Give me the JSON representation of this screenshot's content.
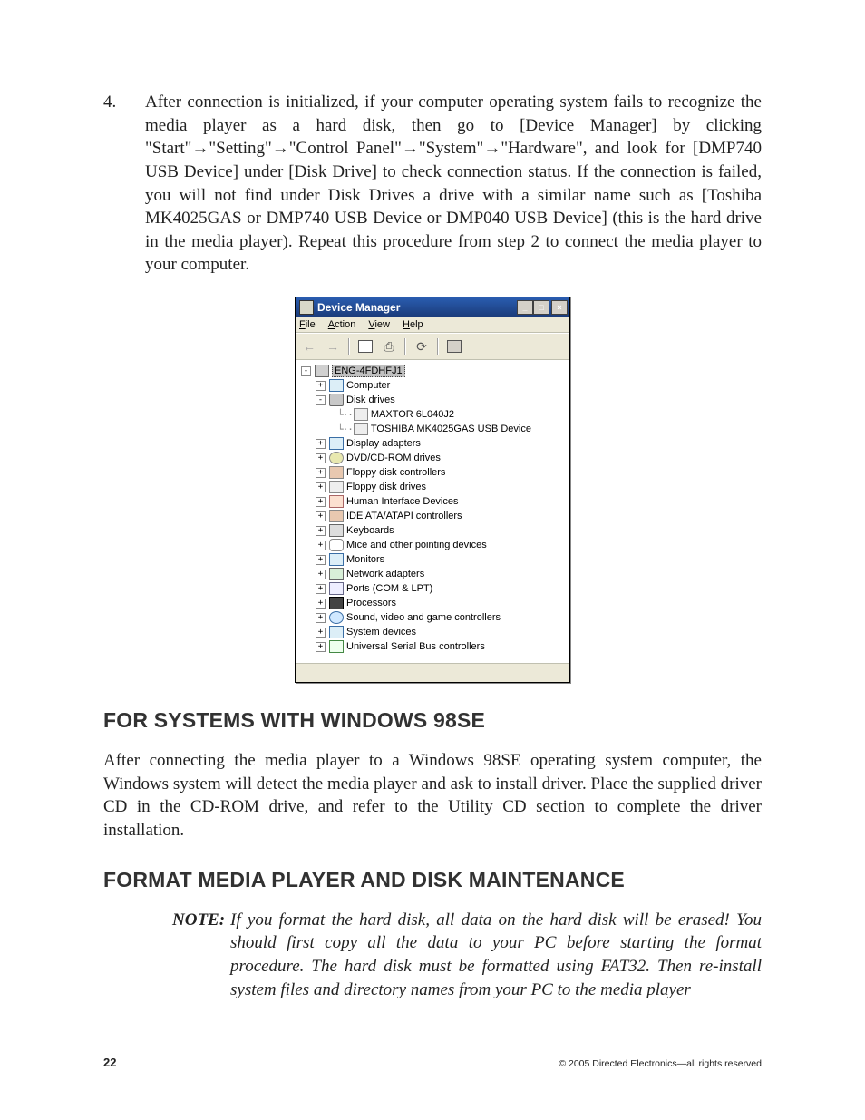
{
  "step": {
    "number": "4.",
    "text_part_1": "After connection is initialized, if your computer operating system fails to recognize the media player as a hard disk, then go to [Device Manager] by clicking \"Start\"",
    "arrow": "→",
    "text_part_2": "\"Setting\"",
    "text_part_3": "\"Control Panel\"",
    "text_part_4": "\"System\"",
    "text_part_5": "\"Hardware\", and look for [DMP740 USB Device] under [Disk Drive] to check connection status. If the connection is failed, you will not find under Disk Drives a drive with a similar name such as [Toshiba MK4025GAS or DMP740 USB Device or DMP040 USB Device] (this is the hard drive in the media player). Repeat this procedure from step 2 to connect the media player to your computer."
  },
  "device_manager": {
    "title": "Device Manager",
    "sysbtns": {
      "minimize": "_",
      "maximize": "□",
      "close": "×"
    },
    "menus": {
      "file_u": "F",
      "file": "ile",
      "action_u": "A",
      "action": "ction",
      "view_u": "V",
      "view": "iew",
      "help_u": "H",
      "help": "elp"
    },
    "root": "ENG-4FDHFJ1",
    "items": [
      {
        "exp": "+",
        "icon": "ico-monitor",
        "label": "Computer",
        "indent": 1
      },
      {
        "exp": "-",
        "icon": "ico-disk",
        "label": "Disk drives",
        "indent": 1
      },
      {
        "exp": "",
        "icon": "ico-drive",
        "label": "MAXTOR 6L040J2",
        "indent": 2
      },
      {
        "exp": "",
        "icon": "ico-drive",
        "label": "TOSHIBA MK4025GAS USB Device",
        "indent": 2
      },
      {
        "exp": "+",
        "icon": "ico-monitor",
        "label": "Display adapters",
        "indent": 1
      },
      {
        "exp": "+",
        "icon": "ico-cd",
        "label": "DVD/CD-ROM drives",
        "indent": 1
      },
      {
        "exp": "+",
        "icon": "ico-chip",
        "label": "Floppy disk controllers",
        "indent": 1
      },
      {
        "exp": "+",
        "icon": "ico-drive",
        "label": "Floppy disk drives",
        "indent": 1
      },
      {
        "exp": "+",
        "icon": "ico-hid",
        "label": "Human Interface Devices",
        "indent": 1
      },
      {
        "exp": "+",
        "icon": "ico-chip",
        "label": "IDE ATA/ATAPI controllers",
        "indent": 1
      },
      {
        "exp": "+",
        "icon": "ico-kbd",
        "label": "Keyboards",
        "indent": 1
      },
      {
        "exp": "+",
        "icon": "ico-mouse",
        "label": "Mice and other pointing devices",
        "indent": 1
      },
      {
        "exp": "+",
        "icon": "ico-monitor",
        "label": "Monitors",
        "indent": 1
      },
      {
        "exp": "+",
        "icon": "ico-net",
        "label": "Network adapters",
        "indent": 1
      },
      {
        "exp": "+",
        "icon": "ico-port",
        "label": "Ports (COM & LPT)",
        "indent": 1
      },
      {
        "exp": "+",
        "icon": "ico-cpu",
        "label": "Processors",
        "indent": 1
      },
      {
        "exp": "+",
        "icon": "ico-sound",
        "label": "Sound, video and game controllers",
        "indent": 1
      },
      {
        "exp": "+",
        "icon": "ico-monitor",
        "label": "System devices",
        "indent": 1
      },
      {
        "exp": "+",
        "icon": "ico-usb",
        "label": "Universal Serial Bus controllers",
        "indent": 1
      }
    ]
  },
  "section1": {
    "heading": "FOR SYSTEMS WITH WINDOWS 98SE",
    "body": "After connecting the media player to a Windows 98SE operating system computer, the Windows system will detect the media player and ask to install driver. Place the supplied driver CD in the CD-ROM drive, and refer to the Utility CD section to complete the driver installation."
  },
  "section2": {
    "heading": "FORMAT MEDIA PLAYER AND DISK MAINTENANCE",
    "note_label": "NOTE:",
    "note_body": "If you format the hard disk, all data on the hard disk will be erased! You should first copy all the data to your PC before starting the format procedure. The hard disk must be formatted using FAT32. Then re-install system files and directory names from your PC to the media player"
  },
  "footer": {
    "page": "22",
    "copyright": "© 2005 Directed Electronics—all rights reserved"
  }
}
